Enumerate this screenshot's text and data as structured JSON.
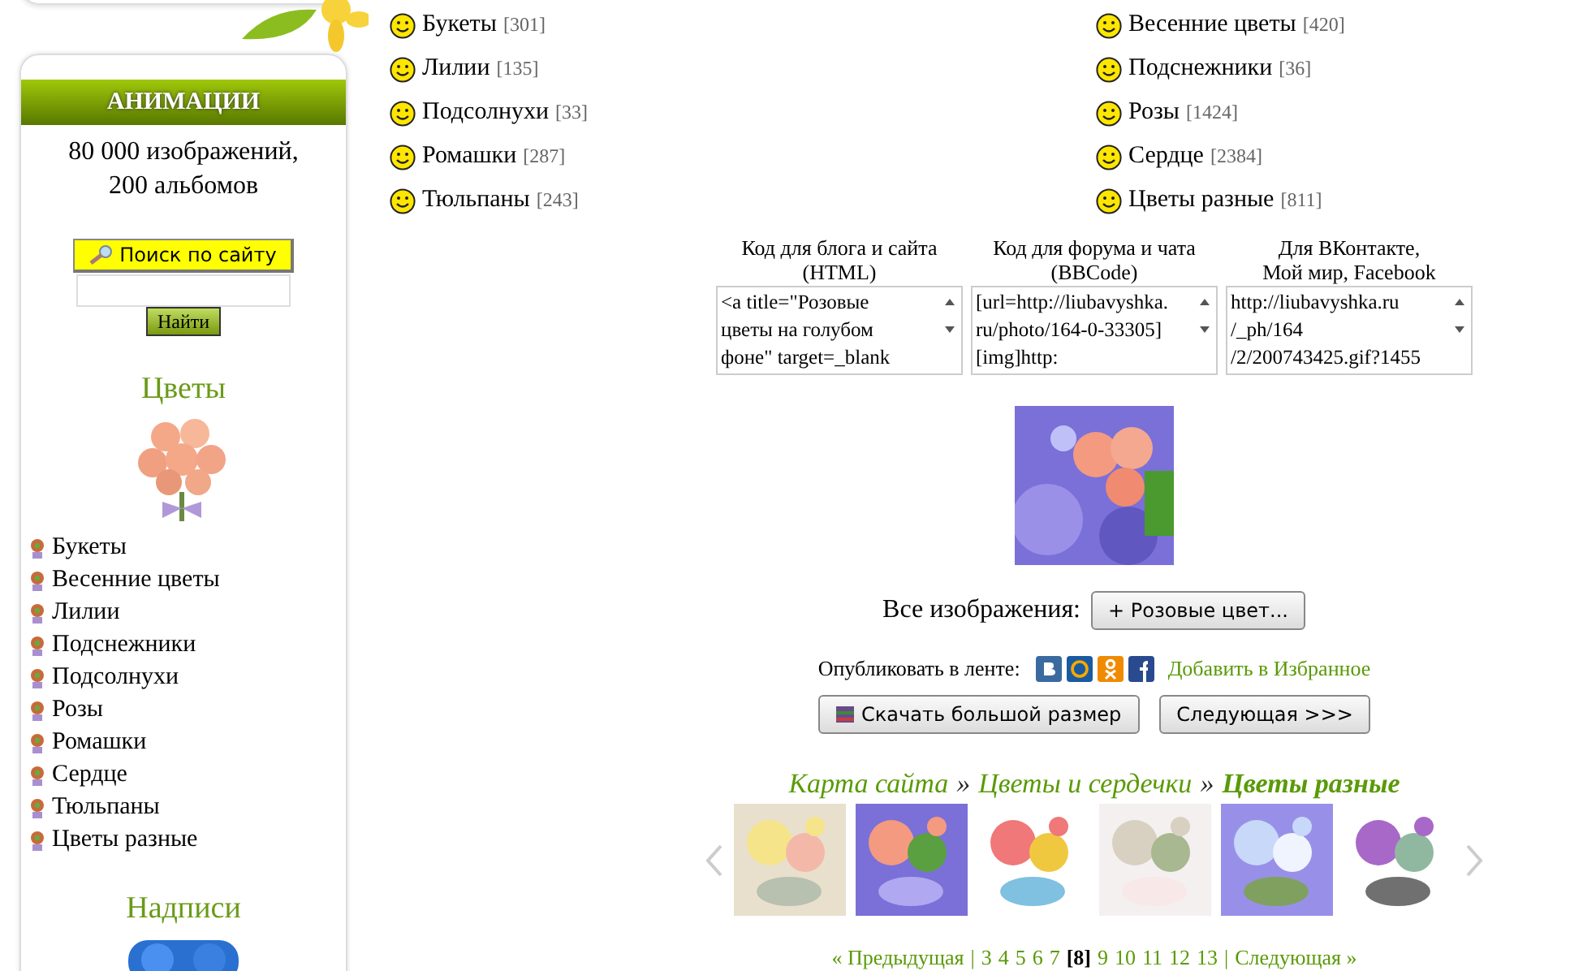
{
  "sidebar": {
    "header": "АНИМАЦИИ",
    "stats": [
      "80 000 изображений,",
      "200 альбомов"
    ],
    "search_button": "Поиск по сайту",
    "find_button": "Найти",
    "sections": [
      {
        "title": "Цветы",
        "items": [
          "Букеты",
          "Весенние цветы",
          "Лилии",
          "Подснежники",
          "Подсолнухи",
          "Розы",
          "Ромашки",
          "Сердце",
          "Тюльпаны",
          "Цветы разные"
        ]
      },
      {
        "title": "Надписи"
      }
    ]
  },
  "categories": [
    {
      "name": "Букеты",
      "count": "[301]"
    },
    {
      "name": "Весенние цветы",
      "count": "[420]"
    },
    {
      "name": "Лилии",
      "count": "[135]"
    },
    {
      "name": "Подснежники",
      "count": "[36]"
    },
    {
      "name": "Подсолнухи",
      "count": "[33]"
    },
    {
      "name": "Розы",
      "count": "[1424]"
    },
    {
      "name": "Ромашки",
      "count": "[287]"
    },
    {
      "name": "Сердце",
      "count": "[2384]"
    },
    {
      "name": "Тюльпаны",
      "count": "[243]"
    },
    {
      "name": "Цветы разные",
      "count": "[811]"
    }
  ],
  "code_boxes": [
    {
      "label": [
        "Код для блога и сайта",
        "(HTML)"
      ],
      "value": [
        "<a title=\"Розовые",
        "цветы на голубом",
        "фоне\" target=_blank"
      ]
    },
    {
      "label": [
        "Код для форума и чата",
        "(BBCode)"
      ],
      "value": [
        "[url=http://liubavyshka.",
        "ru/photo/164-0-33305]",
        "[img]http:"
      ]
    },
    {
      "label": [
        "Для ВКонтакте,",
        "Мой мир, Facebook"
      ],
      "value": [
        "http://liubavyshka.ru",
        "/_ph/164",
        "/2/200743425.gif?1455"
      ]
    }
  ],
  "all_images": {
    "label": "Все изображения:",
    "button": "+ Розовые цвет..."
  },
  "publish": {
    "label": "Опубликовать в ленте:",
    "favorites_link": "Добавить в Избранное"
  },
  "buttons": [
    {
      "kind": "download",
      "label": "Скачать большой размер"
    },
    {
      "kind": "next",
      "label": "Следующая >>>"
    }
  ],
  "breadcrumb": {
    "separator": "»",
    "items": [
      {
        "label": "Карта сайта",
        "current": false
      },
      {
        "label": "Цветы и сердечки",
        "current": false
      },
      {
        "label": "Цветы разные",
        "current": true
      }
    ]
  },
  "pagination": {
    "prev": "« Предыдущая",
    "separator": "|",
    "pages": [
      {
        "label": "3",
        "selected": false
      },
      {
        "label": "4",
        "selected": false
      },
      {
        "label": "5",
        "selected": false
      },
      {
        "label": "6",
        "selected": false
      },
      {
        "label": "7",
        "selected": false
      },
      {
        "label": "[8]",
        "selected": true
      },
      {
        "label": "9",
        "selected": false
      },
      {
        "label": "10",
        "selected": false
      },
      {
        "label": "11",
        "selected": false
      },
      {
        "label": "12",
        "selected": false
      },
      {
        "label": "13",
        "selected": false
      }
    ],
    "next": "Следующая »"
  }
}
